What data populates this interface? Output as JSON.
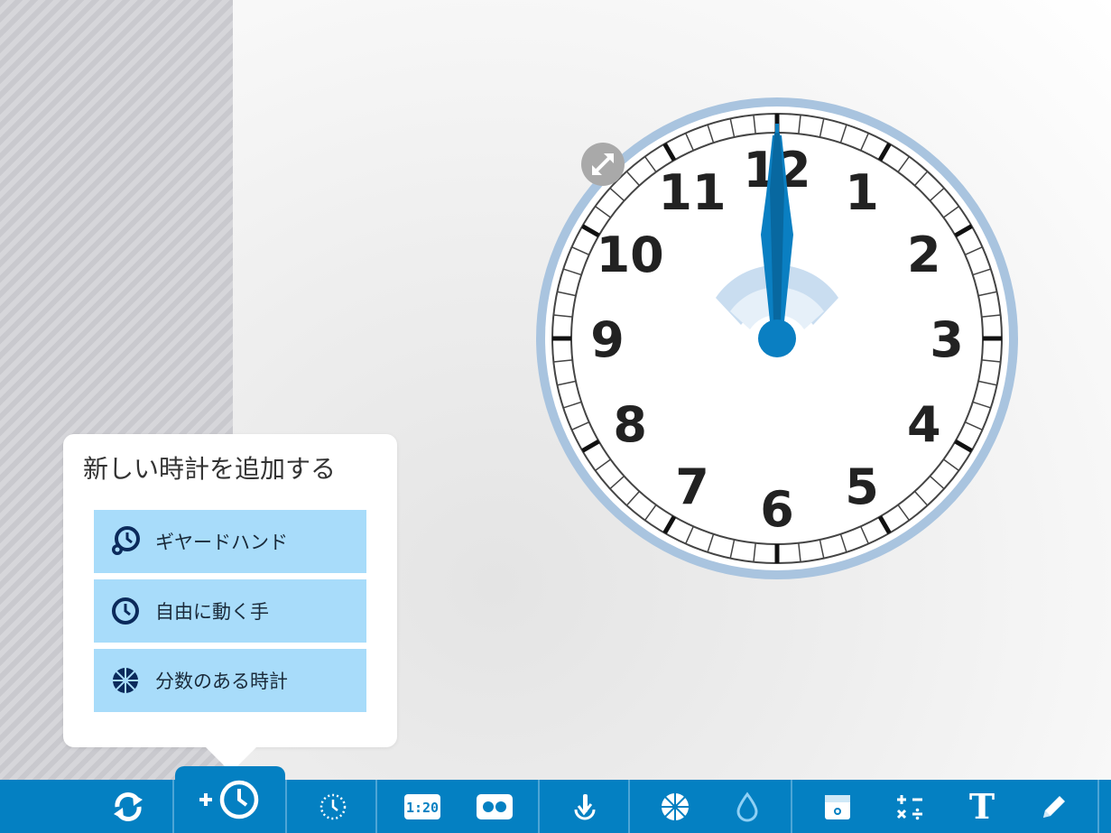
{
  "popup": {
    "title": "新しい時計を追加する",
    "items": [
      {
        "label": "ギヤードハンド",
        "icon": "geared-clock-icon"
      },
      {
        "label": "自由に動く手",
        "icon": "clock-icon"
      },
      {
        "label": "分数のある時計",
        "icon": "fraction-clock-icon"
      }
    ]
  },
  "clock": {
    "numbers": [
      "12",
      "1",
      "2",
      "3",
      "4",
      "5",
      "6",
      "7",
      "8",
      "9",
      "10",
      "11"
    ],
    "hour_hand_value": 12,
    "minute_hand_value": 0,
    "colors": {
      "rim": "#a9c4df",
      "hand": "#0a7fc2",
      "hand_dark": "#0868a0",
      "face": "#ffffff",
      "ticks": "#222222"
    }
  },
  "toolbar": {
    "buttons": [
      {
        "name": "refresh-icon"
      },
      {
        "name": "add-clock-icon"
      },
      {
        "name": "timer-icon"
      },
      {
        "name": "digital-time-icon",
        "text": "1:20"
      },
      {
        "name": "dual-display-icon"
      },
      {
        "name": "hand-tap-icon"
      },
      {
        "name": "fraction-icon"
      },
      {
        "name": "drop-icon"
      },
      {
        "name": "calendar-icon"
      },
      {
        "name": "math-operations-icon"
      },
      {
        "name": "text-tool-icon",
        "text": "T"
      },
      {
        "name": "pencil-icon"
      }
    ],
    "accent": "#0480c2",
    "highlight_bg": "#a8dcfa"
  }
}
